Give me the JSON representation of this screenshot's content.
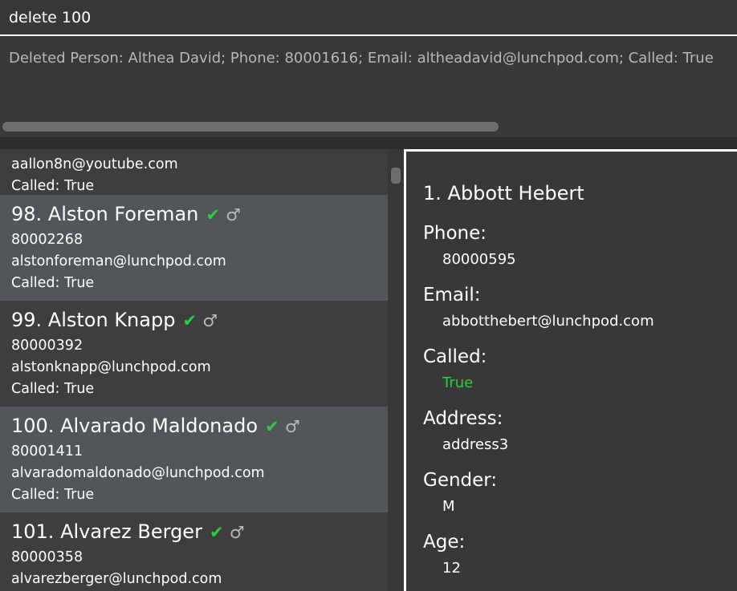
{
  "command": {
    "value": "delete 100",
    "placeholder": ""
  },
  "result": {
    "text": "Deleted Person: Althea David; Phone: 80001616; Email: altheadavid@lunchpod.com; Called: True"
  },
  "list": {
    "partial_card": {
      "email": "aallon8n@youtube.com",
      "called": "Called: True"
    },
    "cards": [
      {
        "index_name": "98.  Alston Foreman",
        "phone": "80002268",
        "email": "alstonforeman@lunchpod.com",
        "called": "Called: True",
        "check": "✔",
        "gender_symbol": "♂"
      },
      {
        "index_name": "99.  Alston Knapp",
        "phone": "80000392",
        "email": "alstonknapp@lunchpod.com",
        "called": "Called: True",
        "check": "✔",
        "gender_symbol": "♂"
      },
      {
        "index_name": "100.  Alvarado Maldonado",
        "phone": "80001411",
        "email": "alvaradomaldonado@lunchpod.com",
        "called": "Called: True",
        "check": "✔",
        "gender_symbol": "♂"
      },
      {
        "index_name": "101.  Alvarez Berger",
        "phone": "80000358",
        "email": "alvarezberger@lunchpod.com",
        "called": "",
        "check": "✔",
        "gender_symbol": "♂"
      }
    ]
  },
  "detail": {
    "title": "1.  Abbott Hebert",
    "phone_label": "Phone:",
    "phone": "80000595",
    "email_label": "Email:",
    "email": "abbotthebert@lunchpod.com",
    "called_label": "Called:",
    "called": "True",
    "address_label": "Address:",
    "address": "address3",
    "gender_label": "Gender:",
    "gender": "M",
    "age_label": "Age:",
    "age": "12"
  },
  "colors": {
    "called_true": "#2ecc40",
    "selected_card": "#515658",
    "card": "#3c3e3f",
    "background": "#383838"
  },
  "icons": {
    "called_indicator": "check-icon",
    "gender_indicator": "male-icon"
  }
}
